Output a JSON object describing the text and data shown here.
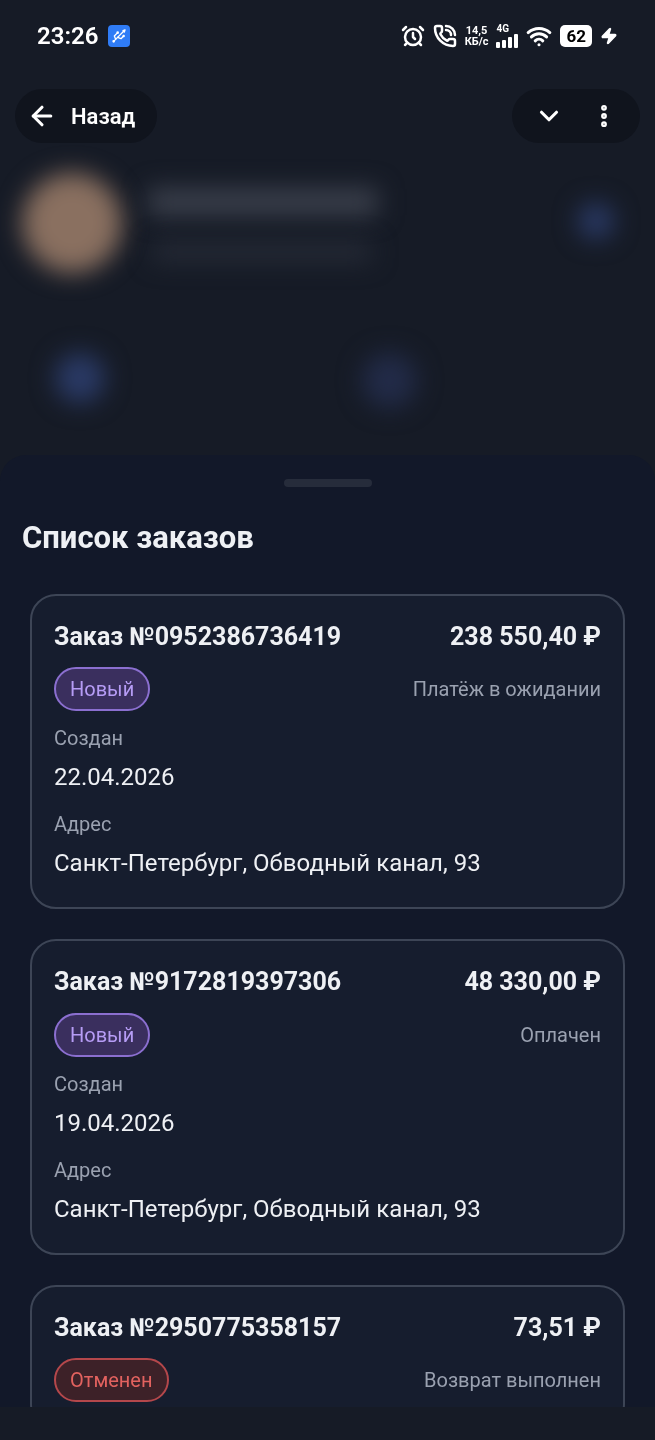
{
  "status_bar": {
    "time": "23:26",
    "speed_value": "14,5",
    "speed_unit": "КБ/с",
    "network": "4G",
    "battery": "62",
    "charging": true
  },
  "header": {
    "back_label": "Назад"
  },
  "sheet": {
    "title": "Список заказов",
    "orders": [
      {
        "number": "Заказ №0952386736419",
        "amount": "238 550,40 ₽",
        "status": {
          "kind": "new",
          "label": "Новый"
        },
        "payment": "Платёж в ожидании",
        "created_label": "Создан",
        "created": "22.04.2026",
        "address_label": "Адрес",
        "address": "Санкт-Петербург, Обводный канал, 93"
      },
      {
        "number": "Заказ №9172819397306",
        "amount": "48 330,00 ₽",
        "status": {
          "kind": "new",
          "label": "Новый"
        },
        "payment": "Оплачен",
        "created_label": "Создан",
        "created": "19.04.2026",
        "address_label": "Адрес",
        "address": "Санкт-Петербург, Обводный канал, 93"
      },
      {
        "number": "Заказ №2950775358157",
        "amount": "73,51 ₽",
        "status": {
          "kind": "cancelled",
          "label": "Отменен"
        },
        "payment": "Возврат выполнен"
      }
    ]
  }
}
